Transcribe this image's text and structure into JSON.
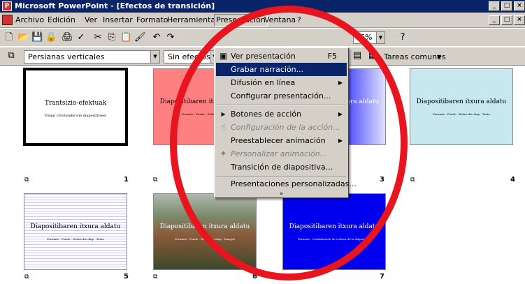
{
  "window": {
    "title": "Microsoft PowerPoint - [Efectos de transición]"
  },
  "menubar": {
    "items": [
      "Archivo",
      "Edición",
      "Ver",
      "Insertar",
      "Formato",
      "Herramientas",
      "Presentación",
      "Ventana",
      "?"
    ]
  },
  "toolbar": {
    "zoom": "66%",
    "transition_effect": "Persianas verticales",
    "sound": "Sin efectos",
    "common_tasks": "Tareas comunes"
  },
  "dropdown": {
    "items": {
      "ver_presentacion": {
        "label": "Ver presentación",
        "shortcut": "F5"
      },
      "grabar_narracion": {
        "label": "Grabar narración..."
      },
      "difusion": {
        "label": "Difusión en línea"
      },
      "configurar": {
        "label": "Configurar presentación..."
      },
      "botones": {
        "label": "Botones de acción"
      },
      "config_accion": {
        "label": "Configuración de la acción..."
      },
      "preestablecer": {
        "label": "Preestablecer animación"
      },
      "personalizar": {
        "label": "Personalizar animación..."
      },
      "transicion": {
        "label": "Transición de diapositiva..."
      },
      "personalizadas": {
        "label": "Presentaciones personalizadas..."
      }
    }
  },
  "slides": [
    {
      "number": "1",
      "title": "Trantsizio-efektuak",
      "subtitle": "Visual ciroilandie die diapositiveen",
      "bg": "#ffffff"
    },
    {
      "number": "2",
      "title": "Diapositibaren itxura aldatu",
      "subtitle": "Formato · Fondo · Esdea die diap",
      "bg": "#ff8080"
    },
    {
      "number": "3",
      "title": "Diapositibaren itxura aldatu",
      "subtitle": "",
      "bg": "#2222dd"
    },
    {
      "number": "4",
      "title": "Diapositibaren itxura aldatu",
      "subtitle": "Formato · Fondo · Esdea die diap · Texto",
      "bg": "#c6e8ee"
    },
    {
      "number": "5",
      "title": "Diapositibaren itxura aldatu",
      "subtitle": "Formato · Fondo · Esdea die diap · Texto",
      "bg": "#ffffff"
    },
    {
      "number": "6",
      "title": "Diapositibaren itxura aldatu",
      "subtitle": "Formato · Fondo · Esdea die diap · Imagen",
      "bg": "#4a5a4a"
    },
    {
      "number": "7",
      "title": "Diapositibaren itxura aldatu",
      "subtitle": "Formato · Combinación de colores de la diapositiva",
      "bg": "#0000ee"
    }
  ],
  "colors": {
    "accent": "#0a246a",
    "highlight_circle": "#e8141e"
  }
}
